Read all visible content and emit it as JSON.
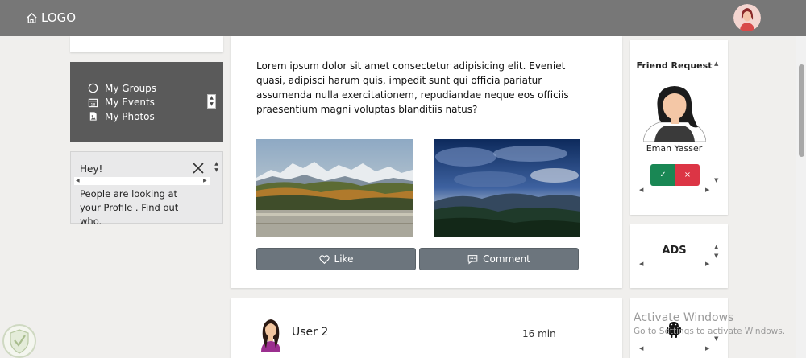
{
  "navbar": {
    "logo_label": "LOGO",
    "home_icon": "home-icon",
    "avatar_icon": "user-avatar"
  },
  "sidebar": {
    "menu": [
      {
        "label": "My Groups",
        "icon": "circle-icon"
      },
      {
        "label": "My Events",
        "icon": "calendar-icon"
      },
      {
        "label": "My Photos",
        "icon": "file-image-icon"
      }
    ],
    "notice": {
      "greeting": "Hey!",
      "message": "People are looking at your Profile . Find out who."
    }
  },
  "post": {
    "text": "Lorem ipsum dolor sit amet consectetur adipisicing elit. Eveniet quasi, adipisci harum quis, impedit sunt qui officia pariatur assumenda nulla exercitationem, repudiandae neque eos officiis praesentium magni voluptas blanditiis natus?",
    "like_label": "Like",
    "comment_label": "Comment"
  },
  "post2": {
    "username": "User 2",
    "time": "16 min"
  },
  "friend_request": {
    "title": "Friend Request",
    "name": "Eman Yasser",
    "accept_symbol": "✓",
    "reject_symbol": "×"
  },
  "ads": {
    "title": "ADS"
  },
  "watermark": {
    "line1": "Activate Windows",
    "line2": "Go to Settings to activate Windows."
  },
  "colors": {
    "navbar": "#777777",
    "sidebar_menu": "#5a5a5a",
    "button_gray": "#6c757d",
    "accept_green": "#198754",
    "reject_red": "#dc3545"
  }
}
